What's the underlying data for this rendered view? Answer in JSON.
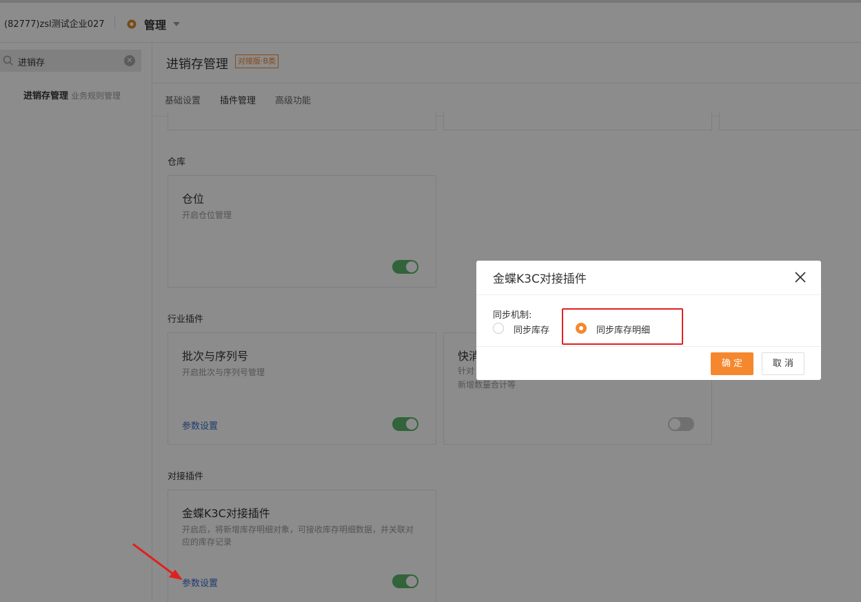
{
  "topbar": {
    "company": "(82777)zsl测试企业027",
    "menu_label": "管理"
  },
  "sidebar": {
    "search_value": "进销存",
    "item_label": "进销存管理",
    "item_sub": "业务规则管理"
  },
  "main": {
    "title": "进销存管理",
    "badge": "对接版·B类",
    "tabs": [
      {
        "label": "基础设置"
      },
      {
        "label": "插件管理"
      },
      {
        "label": "高级功能"
      }
    ],
    "sections": {
      "warehouse": "仓库",
      "industry": "行业插件",
      "integration": "对接插件"
    },
    "cards": {
      "location": {
        "title": "仓位",
        "desc": "开启仓位管理",
        "enabled": true
      },
      "batch": {
        "title": "批次与序列号",
        "desc": "开启批次与序列号管理",
        "link": "参数设置",
        "enabled": true
      },
      "fmcg": {
        "title": "快消",
        "desc_line1": "针对",
        "desc_line2": "新增数量合计等",
        "enabled": false
      },
      "k3c": {
        "title": "金蝶K3C对接插件",
        "desc": "开启后，将新增库存明细对象，可接收库存明细数据，并关联对应的库存记录",
        "link": "参数设置",
        "enabled": true
      }
    }
  },
  "modal": {
    "title": "金蝶K3C对接插件",
    "field_label": "同步机制:",
    "options": [
      {
        "label": "同步库存",
        "selected": false
      },
      {
        "label": "同步库存明细",
        "selected": true
      }
    ],
    "ok_label": "确 定",
    "cancel_label": "取 消"
  },
  "colors": {
    "accent": "#f5882f",
    "toggle_on": "#5bb56a",
    "link": "#3a6ec8",
    "highlight": "#e02020"
  }
}
